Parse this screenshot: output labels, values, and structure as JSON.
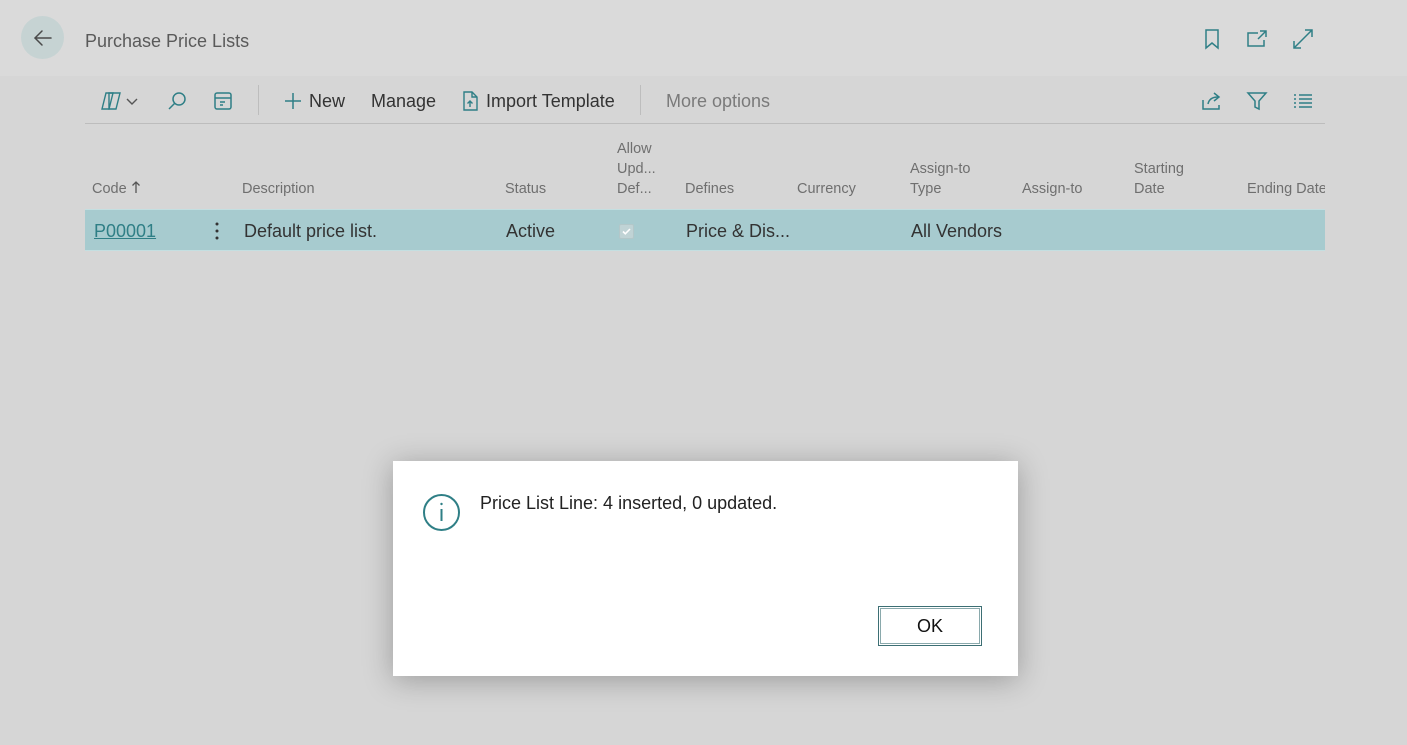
{
  "header": {
    "title": "Purchase Price Lists",
    "icons": [
      "back-arrow-icon",
      "bookmark-icon",
      "open-in-new-window-icon",
      "expand-icon"
    ]
  },
  "actionbar": {
    "new_label": "New",
    "manage_label": "Manage",
    "import_template_label": "Import Template",
    "more_options_label": "More options"
  },
  "table": {
    "columns": {
      "code": "Code",
      "description": "Description",
      "status": "Status",
      "allow_line1": "Allow",
      "allow_line2": "Upd...",
      "allow_line3": "Def...",
      "defines": "Defines",
      "currency": "Currency",
      "assign_type_line1": "Assign-to",
      "assign_type_line2": "Type",
      "assign_to": "Assign-to",
      "starting_line1": "Starting",
      "starting_line2": "Date",
      "ending_date": "Ending Date"
    },
    "rows": [
      {
        "code": "P00001",
        "description": "Default price list.",
        "status": "Active",
        "allow_updating_defaults": true,
        "defines": "Price & Dis...",
        "currency": "",
        "assign_to_type": "All Vendors",
        "assign_to": "",
        "starting_date": "",
        "ending_date": ""
      }
    ]
  },
  "dialog": {
    "message": "Price List Line: 4 inserted, 0 updated.",
    "ok_label": "OK"
  },
  "colors": {
    "accent": "#2f7f86",
    "selected_row": "#a7cbcf",
    "background": "#d6d6d6"
  }
}
